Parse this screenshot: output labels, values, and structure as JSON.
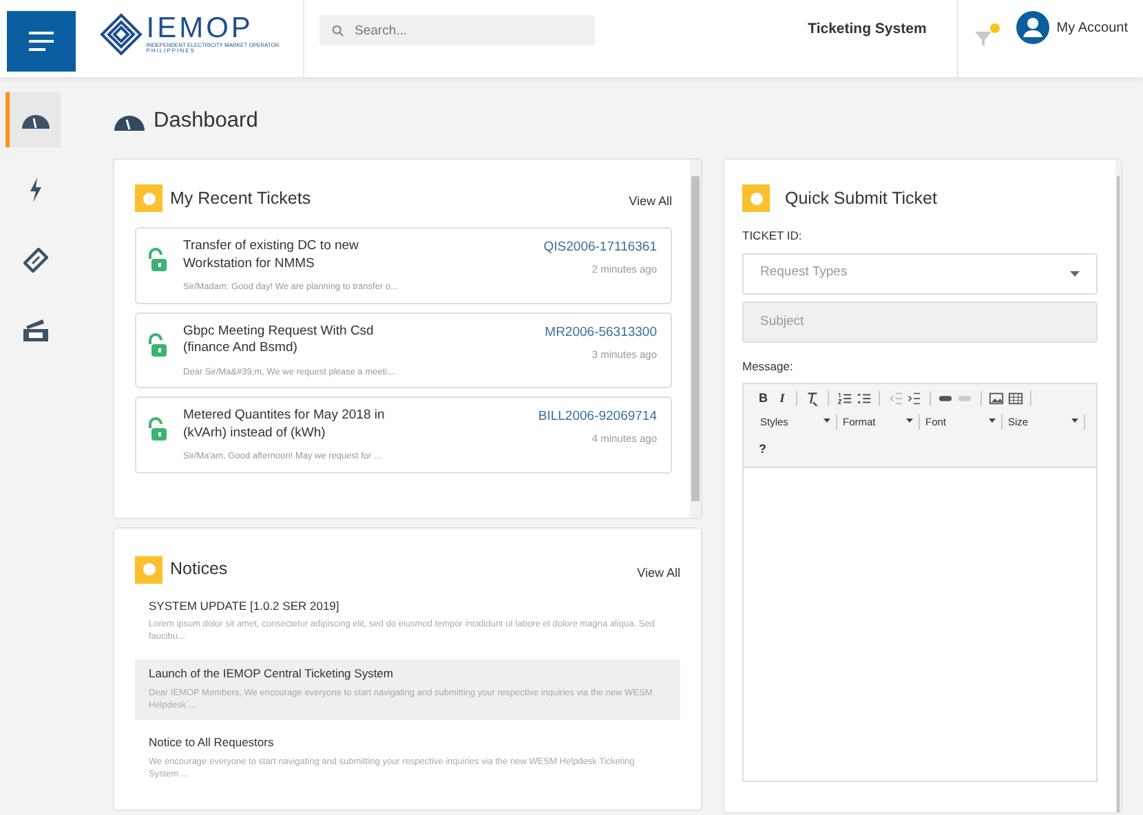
{
  "header": {
    "logo_text": "IEMOP",
    "logo_subtitle": "INDEPENDENT ELECTRICITY MARKET OPERATOR",
    "logo_country": "PHILIPPINES",
    "search": {
      "placeholder": "Search..."
    },
    "app_title": "Ticketing System",
    "notifications": {
      "unread": true
    },
    "account": "My Account"
  },
  "sidebar": {
    "items": [
      {
        "selected": true
      },
      {
        "selected": false
      },
      {
        "selected": false
      },
      {
        "selected": false
      }
    ]
  },
  "page_title": "Dashboard",
  "recent_tickets": {
    "title": "My Recent Tickets",
    "view_all": "View All",
    "tickets": [
      {
        "title": "Transfer of existing DC to new Workstation for NMMS",
        "id": "QIS2006-17116361",
        "time": "2 minutes ago",
        "snippet": "Sir/Madam: Good day! We are planning to transfer o..."
      },
      {
        "title": "Gbpc Meeting Request With Csd (finance And Bsmd)",
        "id": "MR2006-56313300",
        "time": "3 minutes ago",
        "snippet": "Dear Sir/Ma&#39;m, We we request please a meeti..."
      },
      {
        "title": "Metered Quantites for May 2018 in (kVArh) instead of (kWh)",
        "id": "BILL2006-92069714",
        "time": "4 minutes ago",
        "snippet": "Sir/Ma'am, Good afternoon! May we request for ..."
      }
    ]
  },
  "notices": {
    "title": "Notices",
    "view_all": "View All",
    "items": [
      {
        "title": "SYSTEM UPDATE [1.0.2 SER 2019]",
        "text": "Lorem ipsum dolor sit amet, consectetur adipiscing elit, sed do eiusmod tempor incididunt ut labore et dolore magna aliqua. Sed faucibu...",
        "selected": false
      },
      {
        "title": "Launch of the IEMOP Central Ticketing System",
        "text": "Dear IEMOP Members, We encourage everyone to start navigating and submitting your respective inquiries via the new WESM Helpdesk ...",
        "selected": true
      },
      {
        "title": "Notice to All Requestors",
        "text": "We encourage everyone to start navigating and submitting your respective inquiries via the new WESM Helpdesk Ticketing System ...",
        "selected": false
      }
    ]
  },
  "quick_submit": {
    "title": "Quick Submit Ticket",
    "ticket_id_label": "TICKET ID:",
    "request_type": {
      "placeholder": "Request Types"
    },
    "subject": {
      "placeholder": "Subject"
    },
    "message_label": "Message:",
    "editor": {
      "bold": "B",
      "italic": "I",
      "dropdowns": [
        "Styles",
        "Format",
        "Font",
        "Size"
      ],
      "help": "?"
    }
  }
}
